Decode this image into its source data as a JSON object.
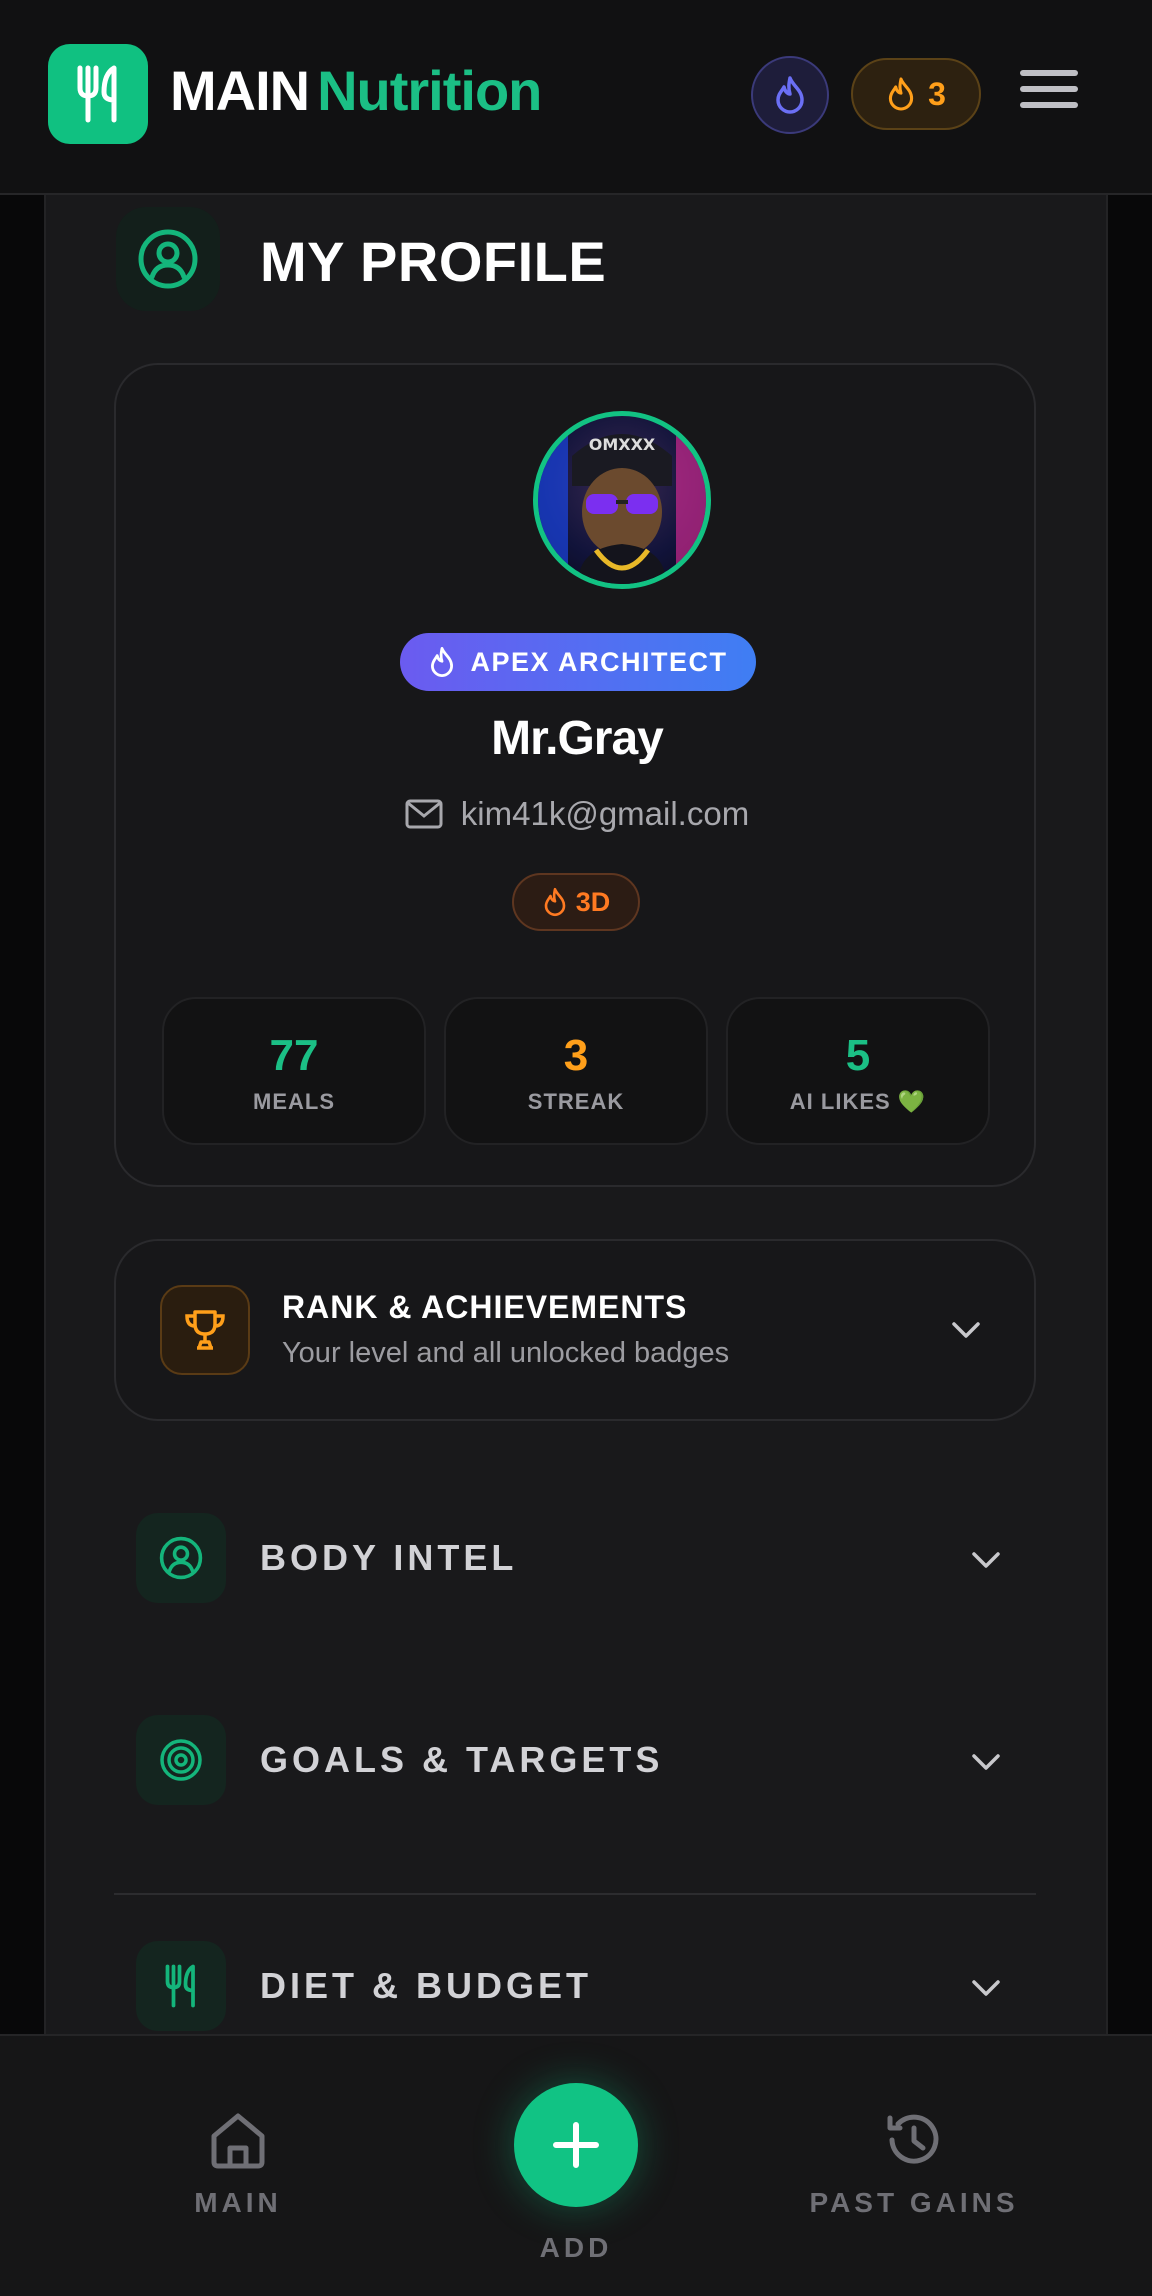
{
  "header": {
    "brand_main": "MAIN",
    "brand_accent": "Nutrition",
    "streak_count": "3"
  },
  "page": {
    "title": "MY PROFILE"
  },
  "profile": {
    "avatar_cap_text": "OMXXX",
    "rank_label": "APEX ARCHITECT",
    "name": "Mr.Gray",
    "email": "kim41k@gmail.com",
    "streak_chip": "3D"
  },
  "stats": [
    {
      "value": "77",
      "label": "MEALS",
      "color": "#1bbf85"
    },
    {
      "value": "3",
      "label": "STREAK",
      "color": "#ff9f1a"
    },
    {
      "value": "5",
      "label": "AI LIKES 💚",
      "color": "#1bbf85"
    }
  ],
  "achievements": {
    "title": "RANK & ACHIEVEMENTS",
    "subtitle": "Your level and all unlocked badges"
  },
  "sections": [
    {
      "label": "BODY INTEL",
      "icon": "user-circle-icon"
    },
    {
      "label": "GOALS & TARGETS",
      "icon": "target-icon"
    },
    {
      "label": "DIET & BUDGET",
      "icon": "utensils-icon"
    }
  ],
  "nav": {
    "main_label": "MAIN",
    "add_label": "ADD",
    "past_label": "PAST GAINS"
  },
  "colors": {
    "accent_green": "#10c181",
    "accent_orange": "#ff9f1a",
    "accent_purple": "#6b5bf0",
    "background": "#19191b"
  }
}
